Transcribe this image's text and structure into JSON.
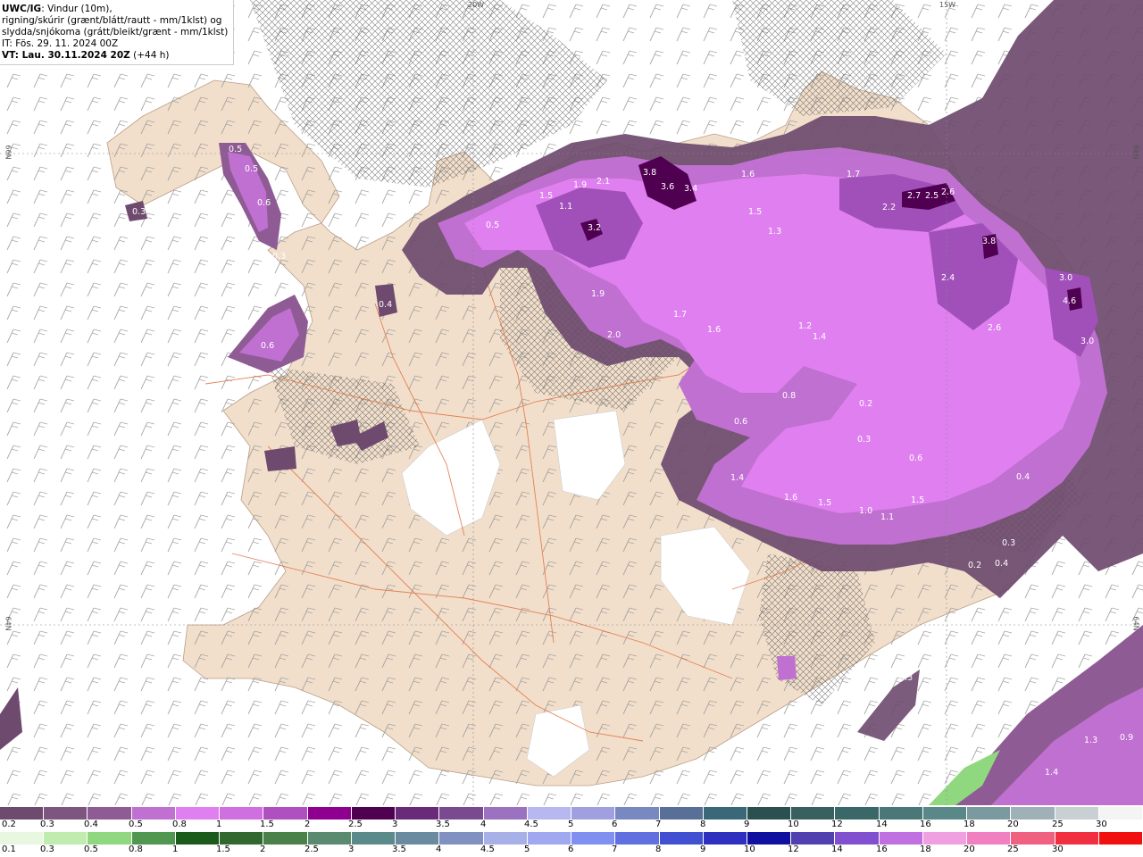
{
  "header": {
    "model": "UWC/IG",
    "line1_rest": ": Vindur (10m),",
    "line2": "rigning/skúrir (grænt/blátt/rautt - mm/1klst) og",
    "line3": "slydda/snjókoma (grátt/bleikt/grænt - mm/1klst)",
    "line4": "IT: Fös. 29. 11. 2024 00Z",
    "line5_bold": "VT: Lau. 30.11.2024 20Z",
    "line5_rest": " (+44 h)"
  },
  "coords": {
    "lon_20w": "20W",
    "lon_15w": "15W",
    "lat_66n_left": "66N",
    "lat_66n_right": "66N",
    "lat_64n_left": "64N",
    "lat_64n_right": "64N"
  },
  "precip_values": [
    {
      "v": "0.5"
    },
    {
      "v": "0.5"
    },
    {
      "v": "0.6"
    },
    {
      "v": "0.3"
    },
    {
      "v": "0.3"
    },
    {
      "v": "0.6"
    },
    {
      "v": "0.4"
    },
    {
      "v": "0.5"
    },
    {
      "v": "1.5"
    },
    {
      "v": "1.9"
    },
    {
      "v": "2.1"
    },
    {
      "v": "1.1"
    },
    {
      "v": "3.8"
    },
    {
      "v": "3.6"
    },
    {
      "v": "3.4"
    },
    {
      "v": "3.2"
    },
    {
      "v": "1.6"
    },
    {
      "v": "1.5"
    },
    {
      "v": "1.3"
    },
    {
      "v": "1.7"
    },
    {
      "v": "2.2"
    },
    {
      "v": "2.7"
    },
    {
      "v": "2.5"
    },
    {
      "v": "2.6"
    },
    {
      "v": "3.8"
    },
    {
      "v": "2.4"
    },
    {
      "v": "3.0"
    },
    {
      "v": "4.6"
    },
    {
      "v": "2.6"
    },
    {
      "v": "3.0"
    },
    {
      "v": "1.9"
    },
    {
      "v": "2.0"
    },
    {
      "v": "1.7"
    },
    {
      "v": "1.6"
    },
    {
      "v": "1.2"
    },
    {
      "v": "1.4"
    },
    {
      "v": "0.8"
    },
    {
      "v": "0.6"
    },
    {
      "v": "1.4"
    },
    {
      "v": "1.6"
    },
    {
      "v": "1.5"
    },
    {
      "v": "1.0"
    },
    {
      "v": "1.1"
    },
    {
      "v": "1.5"
    },
    {
      "v": "0.3"
    },
    {
      "v": "0.4"
    },
    {
      "v": "1.3"
    },
    {
      "v": "0.9"
    },
    {
      "v": "1.4"
    },
    {
      "v": "0.3"
    },
    {
      "v": "0.2"
    },
    {
      "v": "0.3"
    },
    {
      "v": "0.2"
    },
    {
      "v": "0.6"
    },
    {
      "v": "0.4"
    }
  ],
  "legend_snow": {
    "colors": [
      "#6e4a6e",
      "#7e5580",
      "#8e5b94",
      "#c070d0",
      "#e080f0",
      "#d070e0",
      "#b050c0",
      "#900090",
      "#500050",
      "#6a2a7a",
      "#7a4a90",
      "#9a72c0",
      "#b8b8f0",
      "#a0a0e0",
      "#7888c0",
      "#587098",
      "#3a6878",
      "#2a5050",
      "#386060",
      "#3a6868",
      "#4a7878",
      "#5a8888",
      "#7a9aa0",
      "#a0b0b8",
      "#c8d0d4",
      "#f4f4f4"
    ],
    "labels": [
      "0.2",
      "0.3",
      "0.4",
      "0.5",
      "0.8",
      "1",
      "1.5",
      "2",
      "2.5",
      "3",
      "3.5",
      "4",
      "4.5",
      "5",
      "6",
      "7",
      "8",
      "9",
      "10",
      "12",
      "14",
      "16",
      "18",
      "20",
      "25",
      "30"
    ]
  },
  "legend_rain": {
    "colors": [
      "#e8f8e0",
      "#c0ecb0",
      "#90d880",
      "#509850",
      "#1a5a1a",
      "#306830",
      "#4a804a",
      "#5a8a70",
      "#5a8a8a",
      "#6a8aa0",
      "#8090c0",
      "#a8b0e8",
      "#a0a8f0",
      "#8090f0",
      "#6070e0",
      "#4050d0",
      "#3030c0",
      "#1010a0",
      "#5040b0",
      "#8050d0",
      "#c070e0",
      "#f0a0e0",
      "#f080c0",
      "#f06080",
      "#f03040",
      "#f01010"
    ],
    "labels": [
      "0.1",
      "0.3",
      "0.5",
      "0.8",
      "1",
      "1.5",
      "2",
      "2.5",
      "3",
      "3.5",
      "4",
      "4.5",
      "5",
      "6",
      "7",
      "8",
      "9",
      "10",
      "12",
      "14",
      "16",
      "18",
      "20",
      "25",
      "30"
    ]
  }
}
